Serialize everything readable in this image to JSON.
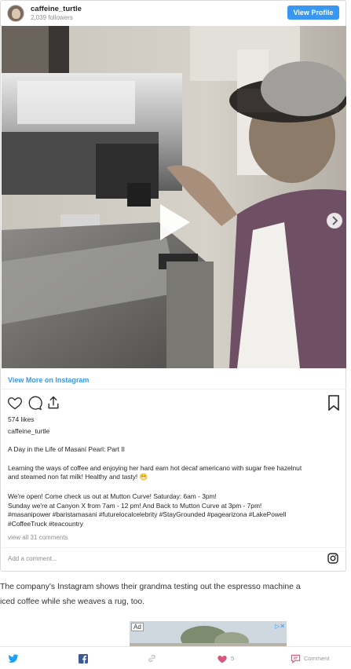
{
  "embed": {
    "username": "caffeine_turtle",
    "followers": "2,039 followers",
    "view_profile": "View Profile",
    "view_more": "View More on Instagram",
    "likes": "574 likes",
    "caption_user": "caffeine_turtle",
    "caption_lines": [
      "A Day in the Life of Masaní Pearl: Part II",
      "Learning the ways of coffee and enjoying her hard earn hot decaf americano with sugar free hazelnut",
      "and steamed non fat milk! Healthy and tasty! 😁",
      "We're open! Come check us out at Mutton Curve! Saturday: 6am - 3pm!",
      "Sunday we're at Canyon X from 7am - 12 pm! And Back to Mutton Curve at 3pm - 7pm!",
      "#masanipower #baristamasani #futurelocalcelebrity #StayGrounded #pagearizona #LakePowell",
      "#CoffeeTruck #teacountry"
    ],
    "view_all_comments": "view all 31 comments",
    "add_comment": "Add a comment...",
    "carousel_dots": 4,
    "carousel_active": 1
  },
  "article": {
    "line1": "The company's Instagram shows their grandma testing out the espresso machine a",
    "line2": "iced coffee while she weaves a rug, too."
  },
  "ad": {
    "label": "Ad"
  },
  "share_bar": {
    "likes_count": "5",
    "comment_label": "Comment"
  },
  "colors": {
    "accent": "#3897f0",
    "like": "#d8557c",
    "twitter": "#1da1f2",
    "facebook": "#3b5998"
  }
}
